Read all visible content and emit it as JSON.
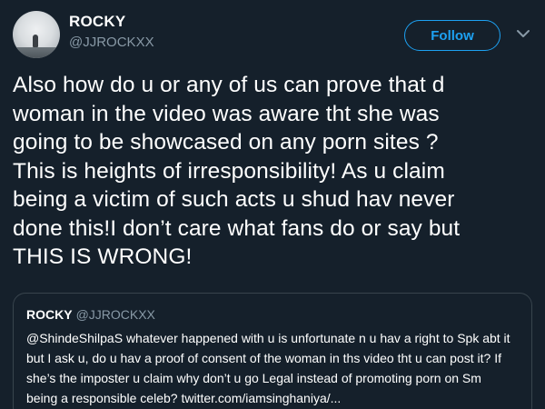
{
  "author": {
    "name": "ROCKY",
    "handle": "@JJROCKXX"
  },
  "follow_label": "Follow",
  "tweet_text": "Also how do u or any of us can prove that d\nwoman in the video was aware tht she was\ngoing to be showcased on any porn sites ?\nThis is heights of irresponsibility! As u claim\nbeing a victim of such acts u shud hav never\ndone this!I don’t care what fans do or say but\nTHIS IS WRONG!",
  "quoted": {
    "name": "ROCKY",
    "handle": "@JJROCKXX",
    "text": "@ShindeShilpaS whatever happened with u is unfortunate n u hav a right to Spk abt it\nbut I ask u, do u hav a proof of consent of the woman in ths video tht u can post it? If\nshe’s the imposter u claim why don’t u go Legal instead of promoting porn on Sm\nbeing a responsible celeb? twitter.com/iamsinghaniya/..."
  },
  "colors": {
    "background": "#15202b",
    "accent": "#1da1f2",
    "secondary_text": "#8899a6",
    "border": "#38444d"
  },
  "icons": {
    "avatar": "avatar-image",
    "menu": "chevron-down-icon"
  }
}
